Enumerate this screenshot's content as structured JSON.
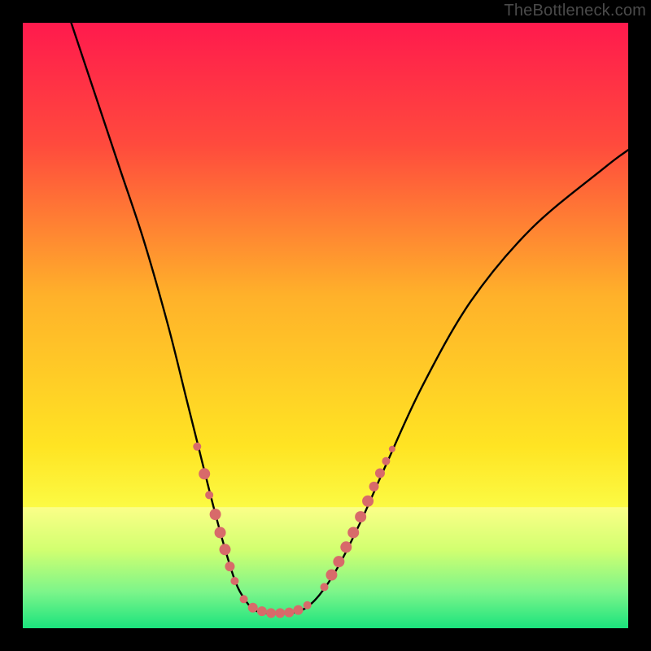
{
  "watermark": "TheBottleneck.com",
  "chart_data": {
    "type": "line",
    "title": "",
    "xlabel": "",
    "ylabel": "",
    "xlim": [
      0,
      100
    ],
    "ylim": [
      0,
      100
    ],
    "background_gradient": {
      "stops": [
        {
          "offset": 0.0,
          "color": "#ff1a4d"
        },
        {
          "offset": 0.2,
          "color": "#ff4a3d"
        },
        {
          "offset": 0.45,
          "color": "#ffb12a"
        },
        {
          "offset": 0.7,
          "color": "#ffe423"
        },
        {
          "offset": 0.82,
          "color": "#fbff4a"
        },
        {
          "offset": 0.9,
          "color": "#d7ff55"
        },
        {
          "offset": 0.96,
          "color": "#73ff7a"
        },
        {
          "offset": 1.0,
          "color": "#18e87a"
        }
      ]
    },
    "bottom_band": {
      "stops": [
        {
          "offset": 0.0,
          "color": "#fbff88"
        },
        {
          "offset": 0.35,
          "color": "#d2ff70"
        },
        {
          "offset": 0.7,
          "color": "#7cf58a"
        },
        {
          "offset": 1.0,
          "color": "#1be37d"
        }
      ],
      "top_fraction": 0.8
    },
    "curve": {
      "x": [
        8,
        12,
        16,
        20,
        24,
        27,
        29,
        31,
        33,
        35,
        36.5,
        38,
        40,
        44,
        46.5,
        49,
        52,
        56,
        60,
        66,
        74,
        84,
        96,
        100
      ],
      "y": [
        100,
        88,
        76,
        64,
        50,
        38,
        30,
        22,
        14.5,
        8,
        5,
        3.2,
        2.5,
        2.5,
        3.2,
        5.5,
        10,
        18,
        27,
        40,
        54,
        66,
        76,
        79
      ]
    },
    "marker_clusters": [
      {
        "x": 28.8,
        "y": 30.0,
        "r": 5
      },
      {
        "x": 30.0,
        "y": 25.5,
        "r": 7
      },
      {
        "x": 30.8,
        "y": 22.0,
        "r": 5
      },
      {
        "x": 31.8,
        "y": 18.8,
        "r": 7
      },
      {
        "x": 32.6,
        "y": 15.8,
        "r": 7
      },
      {
        "x": 33.4,
        "y": 13.0,
        "r": 7
      },
      {
        "x": 34.2,
        "y": 10.2,
        "r": 6
      },
      {
        "x": 35.0,
        "y": 7.8,
        "r": 5
      },
      {
        "x": 36.5,
        "y": 4.8,
        "r": 5
      },
      {
        "x": 38.0,
        "y": 3.4,
        "r": 6
      },
      {
        "x": 39.5,
        "y": 2.8,
        "r": 6
      },
      {
        "x": 41.0,
        "y": 2.5,
        "r": 6
      },
      {
        "x": 42.5,
        "y": 2.5,
        "r": 6
      },
      {
        "x": 44.0,
        "y": 2.6,
        "r": 6
      },
      {
        "x": 45.5,
        "y": 3.0,
        "r": 6
      },
      {
        "x": 47.0,
        "y": 3.8,
        "r": 5
      },
      {
        "x": 49.8,
        "y": 6.8,
        "r": 5
      },
      {
        "x": 51.0,
        "y": 8.8,
        "r": 7
      },
      {
        "x": 52.2,
        "y": 11.0,
        "r": 7
      },
      {
        "x": 53.4,
        "y": 13.4,
        "r": 7
      },
      {
        "x": 54.6,
        "y": 15.8,
        "r": 7
      },
      {
        "x": 55.8,
        "y": 18.4,
        "r": 7
      },
      {
        "x": 57.0,
        "y": 21.0,
        "r": 7
      },
      {
        "x": 58.0,
        "y": 23.4,
        "r": 6
      },
      {
        "x": 59.0,
        "y": 25.6,
        "r": 6
      },
      {
        "x": 60.0,
        "y": 27.6,
        "r": 5
      },
      {
        "x": 61.0,
        "y": 29.6,
        "r": 4
      }
    ],
    "marker_color": "#d86a6a"
  }
}
